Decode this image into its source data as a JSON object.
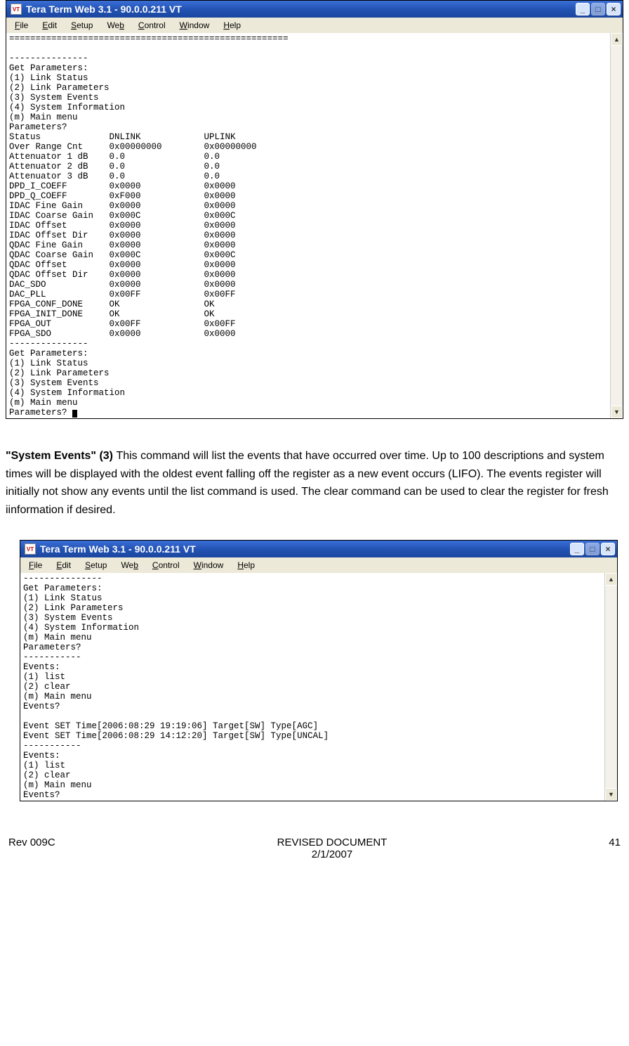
{
  "window1": {
    "title": "Tera Term Web 3.1 - 90.0.0.211 VT",
    "app_icon_text": "VT",
    "menus": [
      "File",
      "Edit",
      "Setup",
      "Web",
      "Control",
      "Window",
      "Help"
    ],
    "menus_underline_idx": [
      0,
      0,
      0,
      2,
      0,
      0,
      0
    ],
    "terminal_lines": [
      "=====================================================",
      "",
      "---------------",
      "Get Parameters:",
      "(1) Link Status",
      "(2) Link Parameters",
      "(3) System Events",
      "(4) System Information",
      "(m) Main menu",
      "Parameters?",
      "Status             DNLINK            UPLINK",
      "Over Range Cnt     0x00000000        0x00000000",
      "Attenuator 1 dB    0.0               0.0",
      "Attenuator 2 dB    0.0               0.0",
      "Attenuator 3 dB    0.0               0.0",
      "DPD_I_COEFF        0x0000            0x0000",
      "DPD_Q_COEFF        0xF000            0x0000",
      "IDAC Fine Gain     0x0000            0x0000",
      "IDAC Coarse Gain   0x000C            0x000C",
      "IDAC Offset        0x0000            0x0000",
      "IDAC Offset Dir    0x0000            0x0000",
      "QDAC Fine Gain     0x0000            0x0000",
      "QDAC Coarse Gain   0x000C            0x000C",
      "QDAC Offset        0x0000            0x0000",
      "QDAC Offset Dir    0x0000            0x0000",
      "DAC_SDO            0x0000            0x0000",
      "DAC_PLL            0x00FF            0x00FF",
      "FPGA_CONF_DONE     OK                OK",
      "FPGA_INIT_DONE     OK                OK",
      "FPGA_OUT           0x00FF            0x00FF",
      "FPGA_SDO           0x0000            0x0000",
      "---------------",
      "Get Parameters:",
      "(1) Link Status",
      "(2) Link Parameters",
      "(3) System Events",
      "(4) System Information",
      "(m) Main menu",
      "Parameters? "
    ],
    "has_cursor": true
  },
  "body_paragraph": {
    "lead": "\"System Events\" (3) ",
    "rest": "This command will list the events that have occurred over time. Up to 100 descriptions and system times will be displayed with the oldest event falling off the register as a new event occurs (LIFO). The events register will initially not show any events until the list command is used. The clear command can be used to clear the register for fresh iinformation if desired."
  },
  "window2": {
    "title": "Tera Term Web 3.1 - 90.0.0.211 VT",
    "app_icon_text": "VT",
    "menus": [
      "File",
      "Edit",
      "Setup",
      "Web",
      "Control",
      "Window",
      "Help"
    ],
    "menus_underline_idx": [
      0,
      0,
      0,
      2,
      0,
      0,
      0
    ],
    "terminal_lines": [
      "---------------",
      "Get Parameters:",
      "(1) Link Status",
      "(2) Link Parameters",
      "(3) System Events",
      "(4) System Information",
      "(m) Main menu",
      "Parameters?",
      "-----------",
      "Events:",
      "(1) list",
      "(2) clear",
      "(m) Main menu",
      "Events?",
      "",
      "Event SET Time[2006:08:29 19:19:06] Target[SW] Type[AGC]",
      "Event SET Time[2006:08:29 14:12:20] Target[SW] Type[UNCAL]",
      "-----------",
      "Events:",
      "(1) list",
      "(2) clear",
      "(m) Main menu",
      "Events?"
    ],
    "has_cursor": false
  },
  "footer": {
    "left": "Rev 009C",
    "center1": "REVISED DOCUMENT",
    "center2": "2/1/2007",
    "right": "41"
  },
  "controls": {
    "minimize": "_",
    "maximize": "□",
    "close": "×",
    "up": "▲",
    "down": "▼"
  }
}
